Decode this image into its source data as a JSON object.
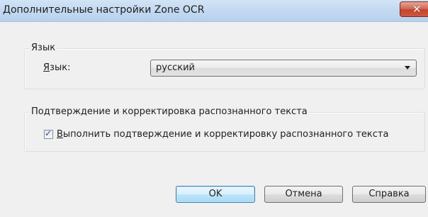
{
  "window": {
    "title": "Дополнительные настройки Zone OCR"
  },
  "language_group": {
    "legend": "Язык",
    "label_first_letter": "Я",
    "label_rest": "зык:",
    "selected_value": "русский"
  },
  "verify_group": {
    "legend": "Подтверждение и корректировка распознанного текста",
    "checkbox_checked": true,
    "checkbox_label_first_letter": "В",
    "checkbox_label_rest": "ыполнить подтверждение и корректировку распознанного текста"
  },
  "buttons": {
    "ok_label": "OK",
    "cancel_label": "Отмена",
    "help_label": "Справка"
  }
}
